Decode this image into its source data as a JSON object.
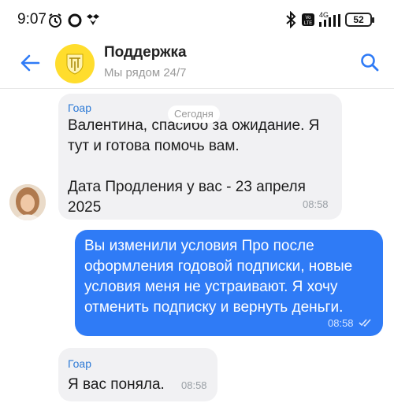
{
  "status": {
    "time": "9:07",
    "battery": "52",
    "network": "4G"
  },
  "header": {
    "title": "Поддержка",
    "subtitle": "Мы рядом 24/7"
  },
  "date_divider": "Сегодня",
  "messages": [
    {
      "sender": "Гоар",
      "text": "Валентина, спасибо за ожидание. Я\nтут и готова помочь вам.\n\nДата Продления у вас - 23 апреля\n2025",
      "time": "08:58"
    },
    {
      "text": "Вы изменили условия Про после\nоформления годовой подписки, новые\nусловия меня не устраивают. Я хочу\nотменить подписку и вернуть деньги.",
      "time": "08:58"
    },
    {
      "sender": "Гоар",
      "text": "Я вас поняла.",
      "time": "08:58"
    }
  ],
  "colors": {
    "accent": "#2f7bf6",
    "incoming_bg": "#f1f1f3",
    "brand_yellow": "#ffdd2d"
  }
}
